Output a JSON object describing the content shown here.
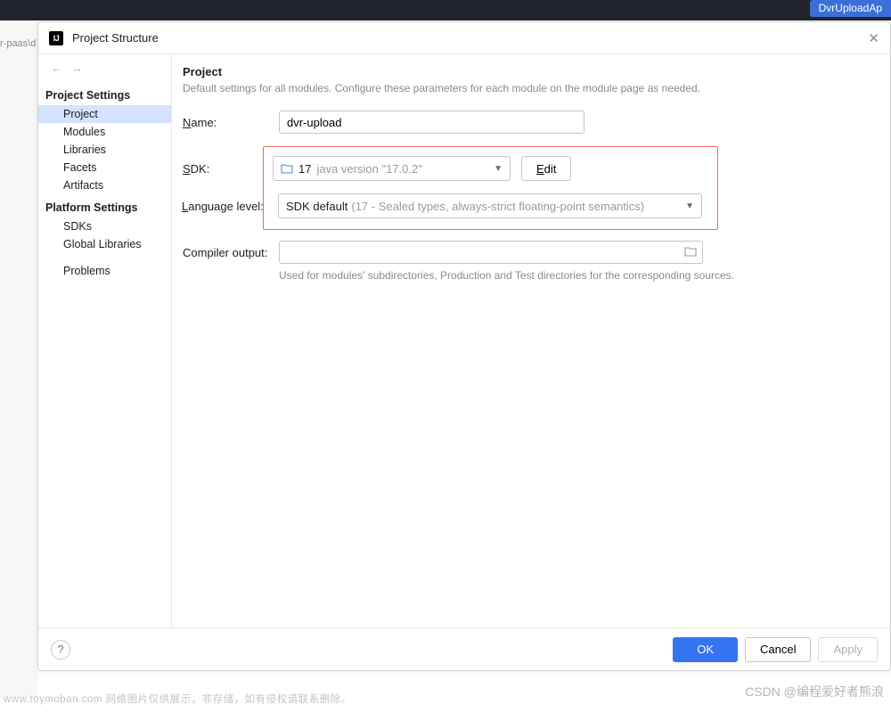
{
  "topbar": {
    "tag": "DvrUploadAp"
  },
  "bg_fragment": "r-paas\\d",
  "dialog": {
    "title": "Project Structure",
    "app_icon_glyph": "IJ"
  },
  "sidebar": {
    "nav_back": "←",
    "nav_forward": "→",
    "section1_title": "Project Settings",
    "section1_items": [
      "Project",
      "Modules",
      "Libraries",
      "Facets",
      "Artifacts"
    ],
    "selected_index": 0,
    "section2_title": "Platform Settings",
    "section2_items": [
      "SDKs",
      "Global Libraries"
    ],
    "section3_items": [
      "Problems"
    ]
  },
  "content": {
    "title": "Project",
    "hint": "Default settings for all modules. Configure these parameters for each module on the module page as needed.",
    "name_label_pre": "N",
    "name_label_post": "ame:",
    "name_value": "dvr-upload",
    "sdk_label_pre": "S",
    "sdk_label_post": "DK:",
    "sdk_version": "17",
    "sdk_detail": "java version \"17.0.2\"",
    "edit_button_pre": "E",
    "edit_button_post": "dit",
    "lang_label_pre": "L",
    "lang_label_post": "anguage level:",
    "lang_default": "SDK default",
    "lang_detail": "(17 - Sealed types, always-strict floating-point semantics)",
    "output_label": "Compiler output:",
    "output_hint": "Used for modules' subdirectories, Production and Test directories for the corresponding sources."
  },
  "footer": {
    "ok": "OK",
    "cancel": "Cancel",
    "apply": "Apply"
  },
  "watermarks": {
    "bottom": "www.toymoban.com 网络图片仅供展示，非存储，如有侵权请联系删除。",
    "right": "CSDN @编程爱好者熊浪"
  }
}
